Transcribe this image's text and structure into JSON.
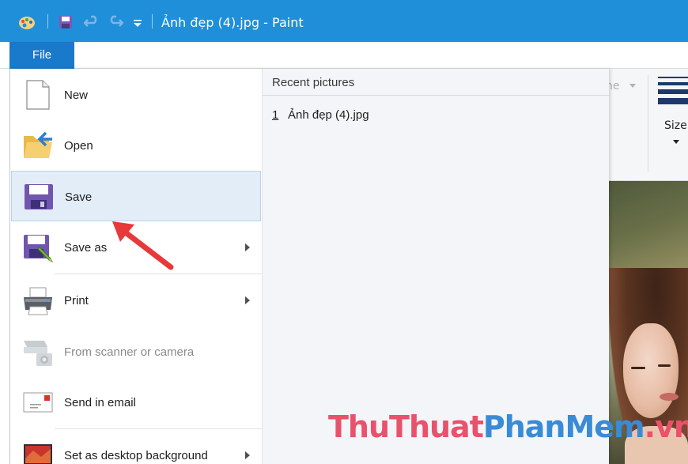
{
  "window": {
    "title": "Ảnh đẹp (4).jpg - Paint",
    "accent_color": "#1f8fd9",
    "quick_access": [
      "paint-app-icon",
      "save-icon",
      "undo-icon",
      "redo-icon",
      "customize-dropdown-icon"
    ]
  },
  "ribbon": {
    "file_tab_label": "File",
    "dimmed_fragment": "ne",
    "size_label": "Size"
  },
  "file_menu": {
    "items": [
      {
        "label": "New",
        "icon": "new-file-icon",
        "submenu": false,
        "enabled": true
      },
      {
        "label": "Open",
        "icon": "open-folder-icon",
        "submenu": false,
        "enabled": true
      },
      {
        "label": "Save",
        "icon": "save-icon",
        "submenu": false,
        "enabled": true,
        "highlighted": true
      },
      {
        "label": "Save as",
        "icon": "save-as-icon",
        "submenu": true,
        "enabled": true
      },
      {
        "label": "Print",
        "icon": "printer-icon",
        "submenu": true,
        "enabled": true
      },
      {
        "label": "From scanner or camera",
        "icon": "scanner-camera-icon",
        "submenu": false,
        "enabled": false
      },
      {
        "label": "Send in email",
        "icon": "email-icon",
        "submenu": false,
        "enabled": true
      },
      {
        "label": "Set as desktop background",
        "icon": "desktop-background-icon",
        "submenu": true,
        "enabled": true
      }
    ]
  },
  "recent": {
    "header": "Recent pictures",
    "items": [
      {
        "number": "1",
        "name": "Ảnh đẹp (4).jpg"
      }
    ]
  },
  "watermark": {
    "part_a": "ThuThuat",
    "part_b": "PhanMem",
    "part_c": ".vn"
  },
  "annotation_color": "#e8393a"
}
